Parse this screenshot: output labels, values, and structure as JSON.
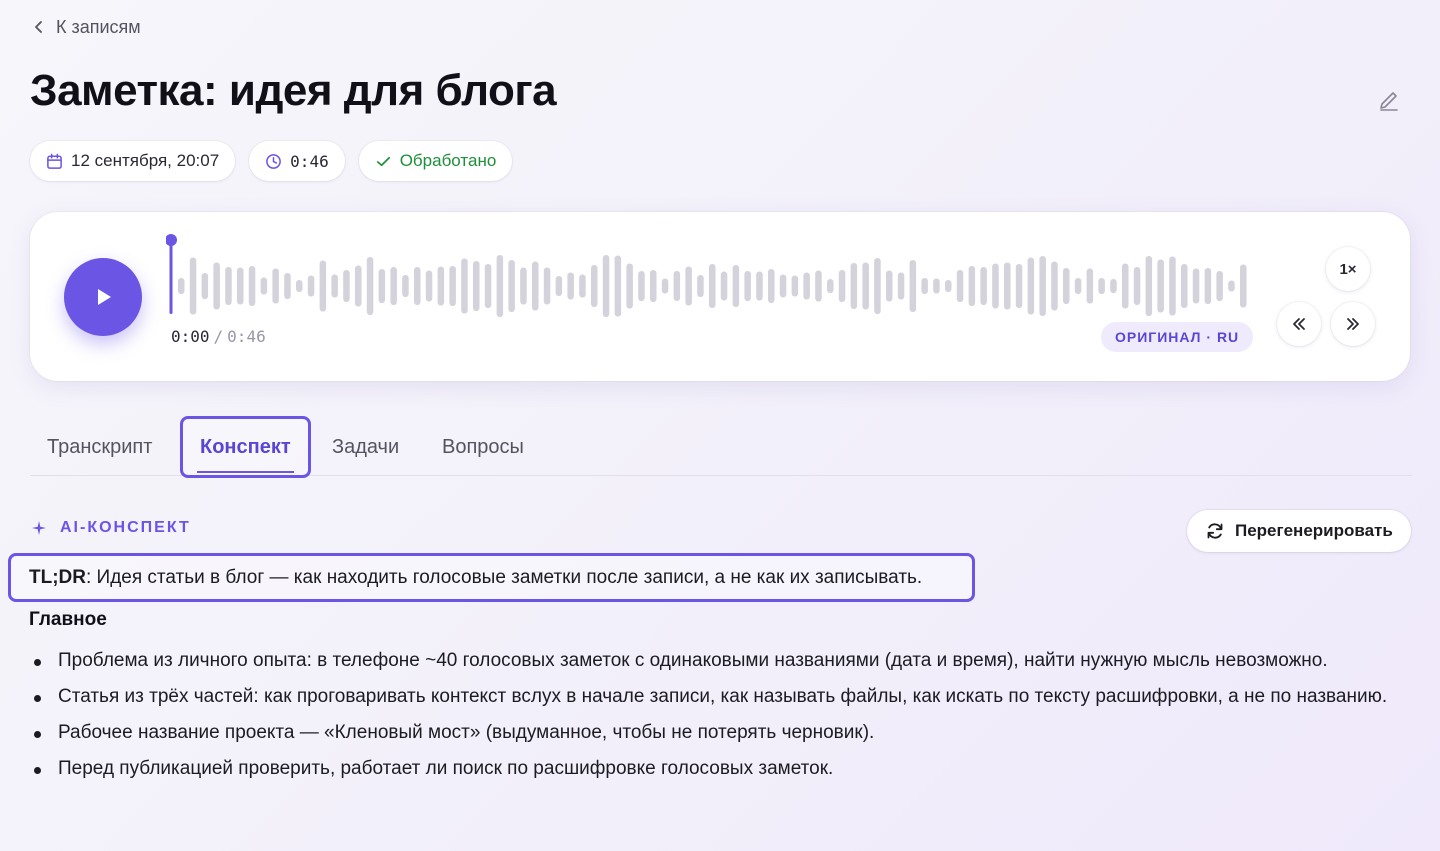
{
  "nav": {
    "back_label": "К записям"
  },
  "header": {
    "title": "Заметка: идея для блога"
  },
  "meta": {
    "date": "12 сентября, 20:07",
    "duration": "0:46",
    "status": "Обработано"
  },
  "player": {
    "current_time": "0:00",
    "separator": "/",
    "total_time": "0:46",
    "progress": 0.0,
    "language_badge": "ОРИГИНАЛ · RU",
    "speed_label": "1×"
  },
  "tabs": [
    {
      "label": "Транскрипт",
      "active": false
    },
    {
      "label": "Конспект",
      "active": true
    },
    {
      "label": "Задачи",
      "active": false
    },
    {
      "label": "Вопросы",
      "active": false
    }
  ],
  "summary": {
    "section_label": "AI-КОНСПЕКТ",
    "regenerate_label": "Перегенерировать",
    "tldr_label": "TL;DR",
    "tldr_text": ": Идея статьи в блог — как находить голосовые заметки после записи, а не как их записывать.",
    "main_heading": "Главное",
    "bullets": [
      "Проблема из личного опыта: в телефоне ~40 голосовых заметок с одинаковыми названиями (дата и время), найти нужную мысль невозможно.",
      "Статья из трёх частей: как проговаривать контекст вслух в начале записи, как называть файлы, как искать по тексту расшифровки, а не по названию.",
      "Рабочее название проекта — «Кленовый мост» (выдуманное, чтобы не потерять черновик).",
      "Перед публикацией проверить, работает ли поиск по расшифровке голосовых заметок."
    ]
  },
  "colors": {
    "accent": "#6a55e5",
    "status_ok": "#1f8f3a",
    "waveform": "#d4d2da"
  }
}
